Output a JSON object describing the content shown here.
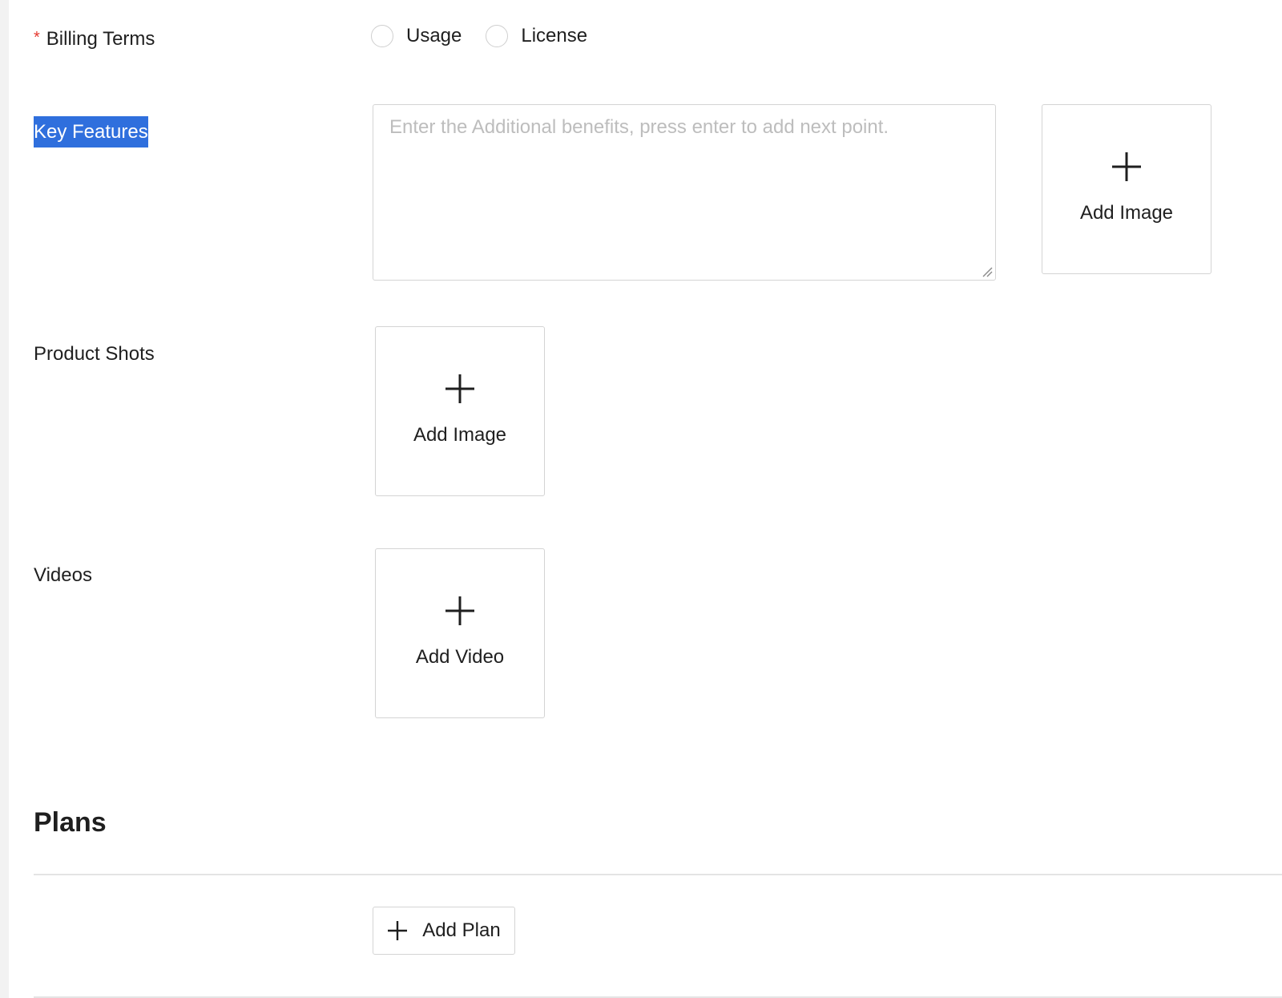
{
  "billing_terms": {
    "label": "Billing Terms",
    "required_marker": "*",
    "options": [
      {
        "label": "Usage",
        "selected": false
      },
      {
        "label": "License",
        "selected": false
      }
    ]
  },
  "key_features": {
    "label": "Key Features",
    "placeholder": "Enter the Additional benefits, press enter to add next point.",
    "value": "",
    "add_image_label": "Add Image"
  },
  "product_shots": {
    "label": "Product Shots",
    "add_image_label": "Add Image"
  },
  "videos": {
    "label": "Videos",
    "add_video_label": "Add Video"
  },
  "plans": {
    "title": "Plans",
    "add_plan_label": "Add Plan"
  },
  "colors": {
    "required": "#e5382f",
    "selection_highlight": "#2f6fdd",
    "border": "#d4d4d4",
    "placeholder": "#bdbdbd"
  },
  "icons": {
    "plus": "plus-icon",
    "resize": "resize-handle-icon"
  }
}
